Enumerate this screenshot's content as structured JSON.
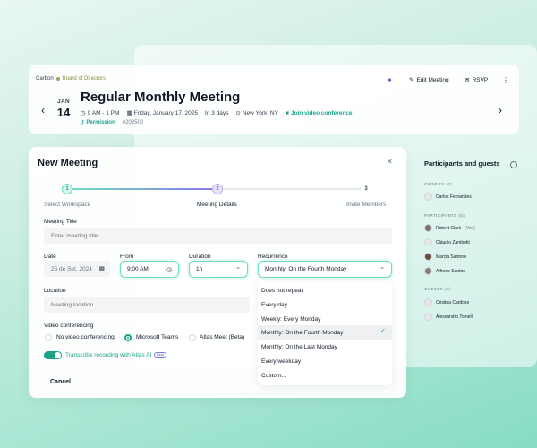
{
  "colors": {
    "accent": "#19a389",
    "accent_border": "#6fdbc0",
    "purple": "#8b7be8"
  },
  "header": {
    "org": "Carbon",
    "board": "Board of Directors",
    "month": "JAN",
    "day": "14",
    "title": "Regular Monthly Meeting",
    "time": "9 AM - 1 PM",
    "date": "Friday, January 17, 2025",
    "relative": "In 3 days",
    "location": "New York, NY",
    "video_link": "Join video conference",
    "permission": "Permission",
    "id": "#202500",
    "edit_label": "Edit Meeting",
    "rsvp_label": "RSVP"
  },
  "participants": {
    "title": "Participants and guests",
    "owners_label": "OWNERS (1)",
    "owners": [
      "Carlos Fernandes"
    ],
    "participants_label": "PARTICIPANTS (5)",
    "participants_list": [
      "Robert Clark",
      "Cláudio Zambotti",
      "Marcia Santoro",
      "Alfredo Santos"
    ],
    "you_tag": "(You)",
    "guests_label": "GUESTS (2)",
    "guests": [
      "Cristina Cardoso",
      "Alessandro Tomelli"
    ]
  },
  "modal": {
    "title": "New Meeting",
    "steps": [
      {
        "num": "1",
        "label": "Select Workspace"
      },
      {
        "num": "2",
        "label": "Meeting Details"
      },
      {
        "num": "3",
        "label": "Invite Members"
      }
    ],
    "meeting_title_label": "Meeting Title",
    "meeting_title_placeholder": "Enter meeting title",
    "date_label": "Date",
    "date_value": "25 de Set, 2024",
    "from_label": "From",
    "from_value": "9:00 AM",
    "duration_label": "Duration",
    "duration_value": "1h",
    "recurrence_label": "Recurrence",
    "recurrence_value": "Monthly: On the Fourth Monday",
    "location_label": "Location",
    "location_placeholder": "Meeting location",
    "video_label": "Video conferencing",
    "video_options": [
      "No video conferencing",
      "Microsoft Teams",
      "Atlas Meet (Beta)"
    ],
    "transcribe_label": "Transcribe recording with Atlas AI",
    "beta_badge": "Beta",
    "cancel_label": "Cancel"
  },
  "recurrence_options": [
    "Does not repeat",
    "Every day",
    "Weekly: Every Monday",
    "Monthly: On the Fourth Monday",
    "Monthly: On the Last Monday",
    "Every weekday",
    "Custom..."
  ]
}
